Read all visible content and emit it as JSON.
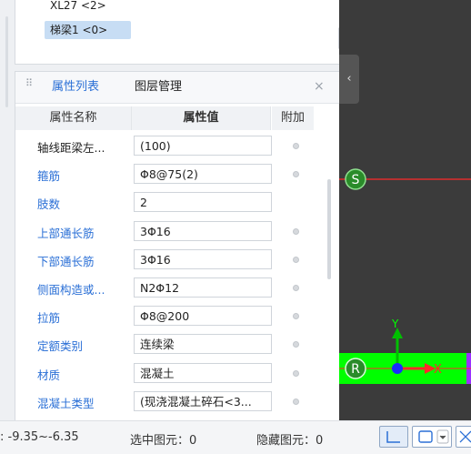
{
  "top_list": {
    "items": [
      {
        "label": "XL27 <2>",
        "selected": false
      },
      {
        "label": "梯梁1 <0>",
        "selected": true
      }
    ]
  },
  "tabs": [
    {
      "label": "属性列表",
      "active": true
    },
    {
      "label": "图层管理",
      "active": false
    }
  ],
  "close_glyph": "×",
  "table": {
    "headers": [
      "属性名称",
      "属性值",
      "附加"
    ],
    "rows": [
      {
        "name": "轴线距梁左...",
        "value": "(100)",
        "blue": false,
        "extra": true
      },
      {
        "name": "箍筋",
        "value": "Φ8@75(2)",
        "blue": true,
        "extra": true
      },
      {
        "name": "肢数",
        "value": "2",
        "blue": true,
        "extra": false
      },
      {
        "name": "上部通长筋",
        "value": "3Φ16",
        "blue": true,
        "extra": true
      },
      {
        "name": "下部通长筋",
        "value": "3Φ16",
        "blue": true,
        "extra": true
      },
      {
        "name": "侧面构造或...",
        "value": "N2Φ12",
        "blue": true,
        "extra": true
      },
      {
        "name": "拉筋",
        "value": "Φ8@200",
        "blue": true,
        "extra": true
      },
      {
        "name": "定额类别",
        "value": "连续梁",
        "blue": true,
        "extra": true
      },
      {
        "name": "材质",
        "value": "混凝土",
        "blue": true,
        "extra": true
      },
      {
        "name": "混凝土类型",
        "value": "(现浇混凝土碎石<3...",
        "blue": true,
        "extra": true
      }
    ]
  },
  "canvas": {
    "marker_s": "S",
    "marker_r": "R",
    "axis_y": "Y",
    "axis_x": "X",
    "colors": {
      "beam": "#00ff00",
      "red_line": "#ff2a2a",
      "marker": "#2a8c2a",
      "origin": "#1a2bff"
    }
  },
  "status": {
    "coord": ": -9.35~-6.35",
    "selected": "选中图元：0",
    "hidden": "隐藏图元：0"
  }
}
